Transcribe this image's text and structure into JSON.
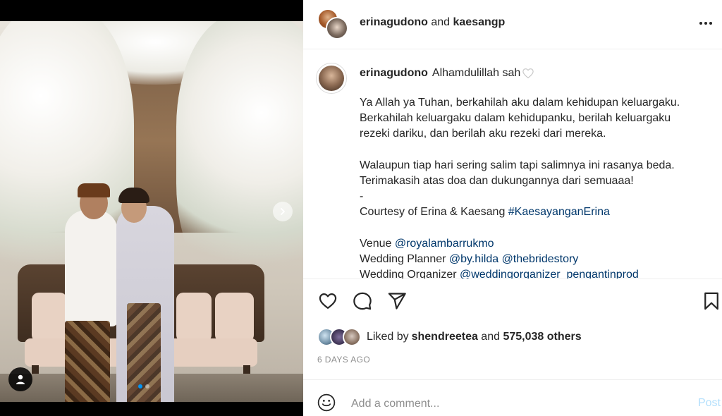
{
  "photo": {
    "carousel_dots": [
      true,
      false
    ]
  },
  "header": {
    "user1": "erinagudono",
    "and_text": "and",
    "user2": "kaesangp"
  },
  "caption": {
    "username": "erinagudono",
    "first_line": "Alhamdulillah sah",
    "lines": [
      {
        "text": "Ya Allah ya Tuhan, berkahilah aku dalam kehidupan keluargaku."
      },
      {
        "text": "Berkahilah keluargaku dalam kehidupanku, berilah keluargaku"
      },
      {
        "text": "rezeki dariku, dan berilah aku rezeki dari mereka."
      },
      {
        "text": ""
      },
      {
        "text": "Walaupun tiap hari sering salim tapi salimnya ini rasanya beda."
      },
      {
        "text": "Terimakasih atas doa dan dukungannya dari semuaaa!"
      },
      {
        "text": "-"
      }
    ],
    "courtesy_prefix": "Courtesy of Erina & Kaesang ",
    "courtesy_tag": "#KaesayanganErina",
    "venue_label": "Venue ",
    "venue_link": "@royalambarrukmo",
    "planner_label": "Wedding Planner ",
    "planner_link1": "@by.hilda",
    "planner_link2": "@thebridestory",
    "organizer_label": "Wedding Organizer ",
    "organizer_link": "@weddingorganizer_pengantinprod"
  },
  "likes": {
    "prefix": "Liked by ",
    "user": "shendreetea",
    "and_text": " and ",
    "others": "575,038 others"
  },
  "date": "6 DAYS AGO",
  "comment": {
    "placeholder": "Add a comment...",
    "post_label": "Post"
  },
  "icons": [
    "heart-icon",
    "comment-icon",
    "share-icon",
    "bookmark-icon",
    "emoji-icon",
    "more-icon",
    "chevron-right-icon",
    "user-tag-icon"
  ],
  "colors": {
    "link": "#00376b",
    "post_disabled": "#b2dffc",
    "muted": "#8e8e8e",
    "carousel_active": "#0095f6"
  }
}
